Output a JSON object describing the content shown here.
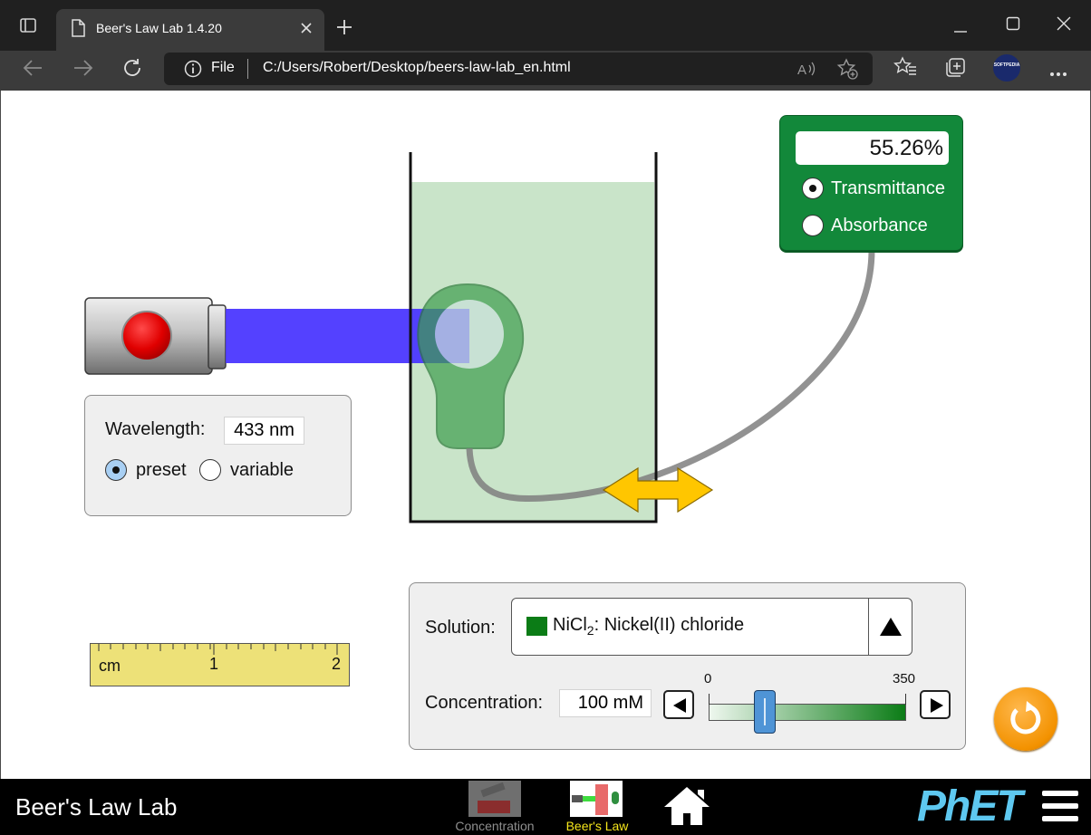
{
  "browser": {
    "tab_title": "Beer's Law Lab 1.4.20",
    "address_label": "File",
    "address_url": "C:/Users/Robert/Desktop/beers-law-lab_en.html",
    "profile_label": "SOFTPEDIA"
  },
  "light": {
    "wavelength_label": "Wavelength:",
    "wavelength_value": "433 nm",
    "mode_preset": "preset",
    "mode_variable": "variable",
    "mode_selected": "preset",
    "beam_color": "#4b37ff"
  },
  "detector": {
    "value": "55.26%",
    "option_transmittance": "Transmittance",
    "option_absorbance": "Absorbance",
    "selected": "Transmittance",
    "color": "#12883a"
  },
  "ruler": {
    "unit": "cm",
    "tick_1": "1",
    "tick_2": "2"
  },
  "solution": {
    "label": "Solution:",
    "swatch_color": "#0b7c16",
    "formula_main": "NiCl",
    "formula_sub": "2",
    "name": ": Nickel(II) chloride",
    "liquid_color": "#c9e4c9"
  },
  "concentration": {
    "label": "Concentration:",
    "value": "100 mM",
    "min_label": "0",
    "max_label": "350",
    "fraction": 0.2857
  },
  "navbar": {
    "title": "Beer's Law Lab",
    "screen_concentration": "Concentration",
    "screen_beers_law": "Beer's Law",
    "active_color": "#f5e61b",
    "brand": "PhET"
  }
}
